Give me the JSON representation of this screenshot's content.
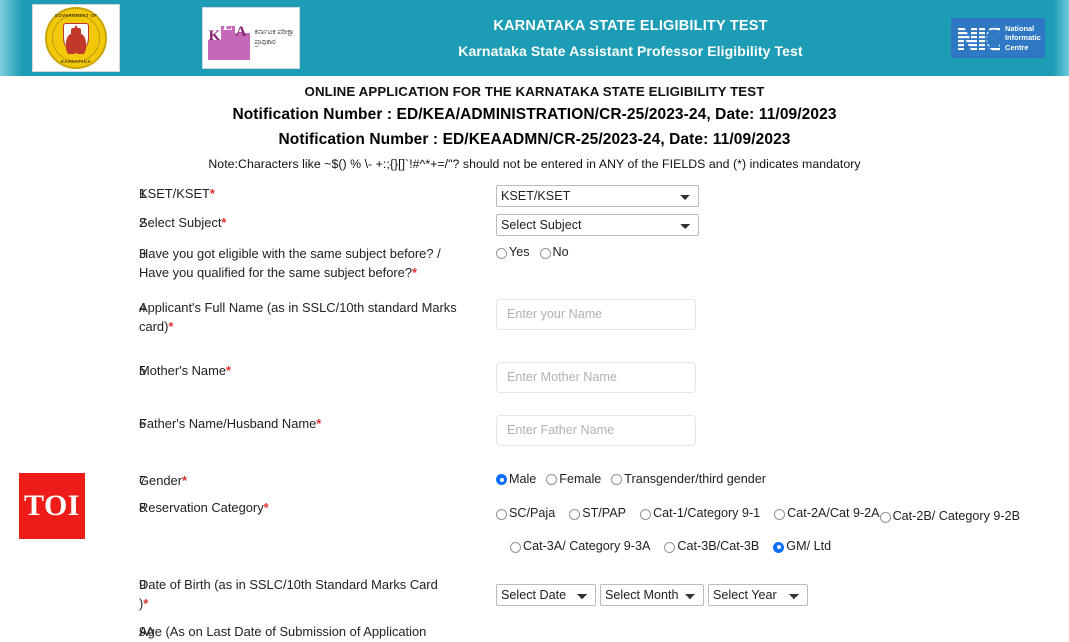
{
  "header": {
    "gok_logo": {
      "text_top": "GOVERNMENT OF",
      "text_bottom": "KARNATAKA"
    },
    "kea_logo": {
      "k": "K",
      "e": "E",
      "a": "A",
      "kannada_line1": "ಕರ್ನಾಟಕ ಪರೀಕ್ಷಾ",
      "kannada_line2": "ಪ್ರಾಧಿಕಾರ"
    },
    "title_main": "KARNATAKA STATE ELIGIBILITY TEST",
    "title_sub": "Karnataka State Assistant Professor Eligibility Test",
    "nic_logo": {
      "mark": "NIC",
      "line1": "National",
      "line2": "Informatic",
      "line3": "Centre"
    },
    "bg_color": "#1c9cb5"
  },
  "page": {
    "heading": "ONLINE APPLICATION FOR THE KARNATAKA STATE ELIGIBILITY TEST",
    "notification_1": "Notification Number : ED/KEA/ADMINISTRATION/CR-25/2023-24, Date: 11/09/2023",
    "notification_2": "Notification Number : ED/KEAADMN/CR-25/2023-24, Date: 11/09/2023",
    "note": "Note:Characters like ~$() % \\- +:;{}[]`!#^*+=/\"? should not be entered in ANY of the FIELDS and (*) indicates mandatory"
  },
  "form": {
    "rows": [
      {
        "num": "1",
        "label": "KSET/KSET",
        "required": true,
        "type": "select",
        "value": "KSET/KSET",
        "options": [
          "KSET/KSET"
        ]
      },
      {
        "num": "2",
        "label": "Select Subject",
        "required": true,
        "type": "select",
        "value": "Select Subject",
        "options": [
          "Select Subject"
        ]
      },
      {
        "num": "3",
        "label_line1": "Have you got eligible with the same subject before? /",
        "label_line2": "Have you qualified for the same subject before?",
        "required": true,
        "type": "radio",
        "options": [
          {
            "label": "Yes",
            "selected": false
          },
          {
            "label": "No",
            "selected": false
          }
        ]
      },
      {
        "num": "4",
        "label_line1": "Applicant's Full Name (as in SSLC/10th standard Marks",
        "label_line2": "card)",
        "required": true,
        "type": "text",
        "value": "",
        "placeholder": "Enter your Name"
      },
      {
        "num": "5",
        "label": "Mother's Name",
        "required": true,
        "type": "text",
        "value": "",
        "placeholder": "Enter Mother Name"
      },
      {
        "num": "6",
        "label": "Father's Name/Husband Name",
        "required": true,
        "type": "text",
        "value": "",
        "placeholder": "Enter Father Name"
      },
      {
        "num": "7",
        "label": "Gender",
        "required": true,
        "type": "radio",
        "options": [
          {
            "label": "Male",
            "selected": true
          },
          {
            "label": "Female",
            "selected": false
          },
          {
            "label": "Transgender/third gender",
            "selected": false
          }
        ]
      },
      {
        "num": "8",
        "label": "Reservation Category",
        "required": true,
        "type": "radio",
        "options": [
          {
            "label": "SC/Paja",
            "selected": false
          },
          {
            "label": "ST/PAP",
            "selected": false
          },
          {
            "label": "Cat-1/Category 9-1",
            "selected": false
          },
          {
            "label": "Cat-2A/Cat 9-2A",
            "selected": false
          },
          {
            "label": "Cat-2B/ Category 9-2B",
            "selected": false
          },
          {
            "label": "Cat-3A/ Category 9-3A",
            "selected": false
          },
          {
            "label": "Cat-3B/Cat-3B",
            "selected": false
          },
          {
            "label": "GM/ Ltd",
            "selected": true
          }
        ]
      },
      {
        "num": "9",
        "label_line1": "Date of Birth (as in SSLC/10th Standard Marks Card",
        "label_line2": ")",
        "required": true,
        "type": "date",
        "date_value": "Select Date",
        "month_value": "Select Month",
        "year_value": "Select Year"
      },
      {
        "num": "9A",
        "label": "Age (As on Last Date of Submission of Application",
        "required": false,
        "type": "none"
      }
    ]
  },
  "watermark": {
    "text": "TOI",
    "color": "#ee1c18"
  }
}
